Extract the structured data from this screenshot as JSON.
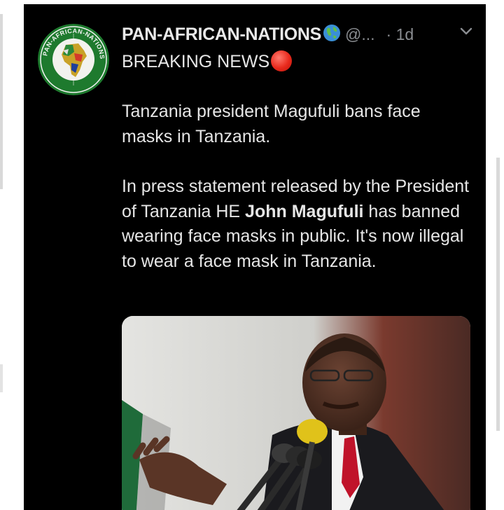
{
  "tweet": {
    "display_name": "PAN-AFRICAN-NATIONS",
    "handle": "@...",
    "time": "· 1d",
    "subtitle": "BREAKING NEWS",
    "paragraph1": "Tanzania president Magufuli bans face masks in Tanzania.",
    "paragraph2_before": "In press statement released by the President of Tanzania HE ",
    "paragraph2_bold": "John Magufuli",
    "paragraph2_after": " has banned wearing face masks in public. It's now illegal to wear a face mask in Tanzania.",
    "avatar_ring_text": "PAN-AFRICAN-NATIONS"
  },
  "icons": {
    "verified": "globe-icon",
    "breaking": "red-circle-icon",
    "menu": "chevron-down-icon"
  },
  "colors": {
    "background": "#000000",
    "text": "#e6e6e6",
    "muted": "#8a8d91",
    "avatar_green": "#1e7a2e",
    "breaking_red": "#e8291c"
  }
}
